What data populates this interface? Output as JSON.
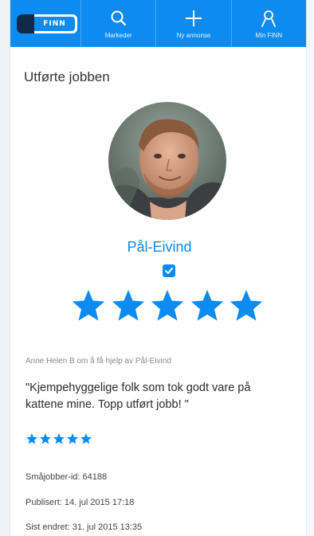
{
  "app": {
    "logo_text": "FINN",
    "accent_color": "#0d8bf0"
  },
  "nav": {
    "items": [
      {
        "label": "Markeder",
        "icon": "search-icon"
      },
      {
        "label": "Ny annonse",
        "icon": "plus-icon"
      },
      {
        "label": "Min FINN",
        "icon": "user-icon"
      }
    ]
  },
  "page": {
    "title": "Utførte jobben"
  },
  "profile": {
    "name": "Pål-Eivind",
    "verified": true,
    "rating": 5
  },
  "review": {
    "author_line": "Anne Helen B om å få hjelp av Pål-Eivind",
    "text": "\"Kjempehyggelige folk som tok godt vare på kattene mine. Topp utført jobb! \"",
    "rating": 5
  },
  "meta": {
    "id_line": "Småjobber-id: 64188",
    "published_line": "Publisert: 14. jul 2015 17:18",
    "edited_line": "Sist endret: 31. jul 2015 13:35"
  }
}
